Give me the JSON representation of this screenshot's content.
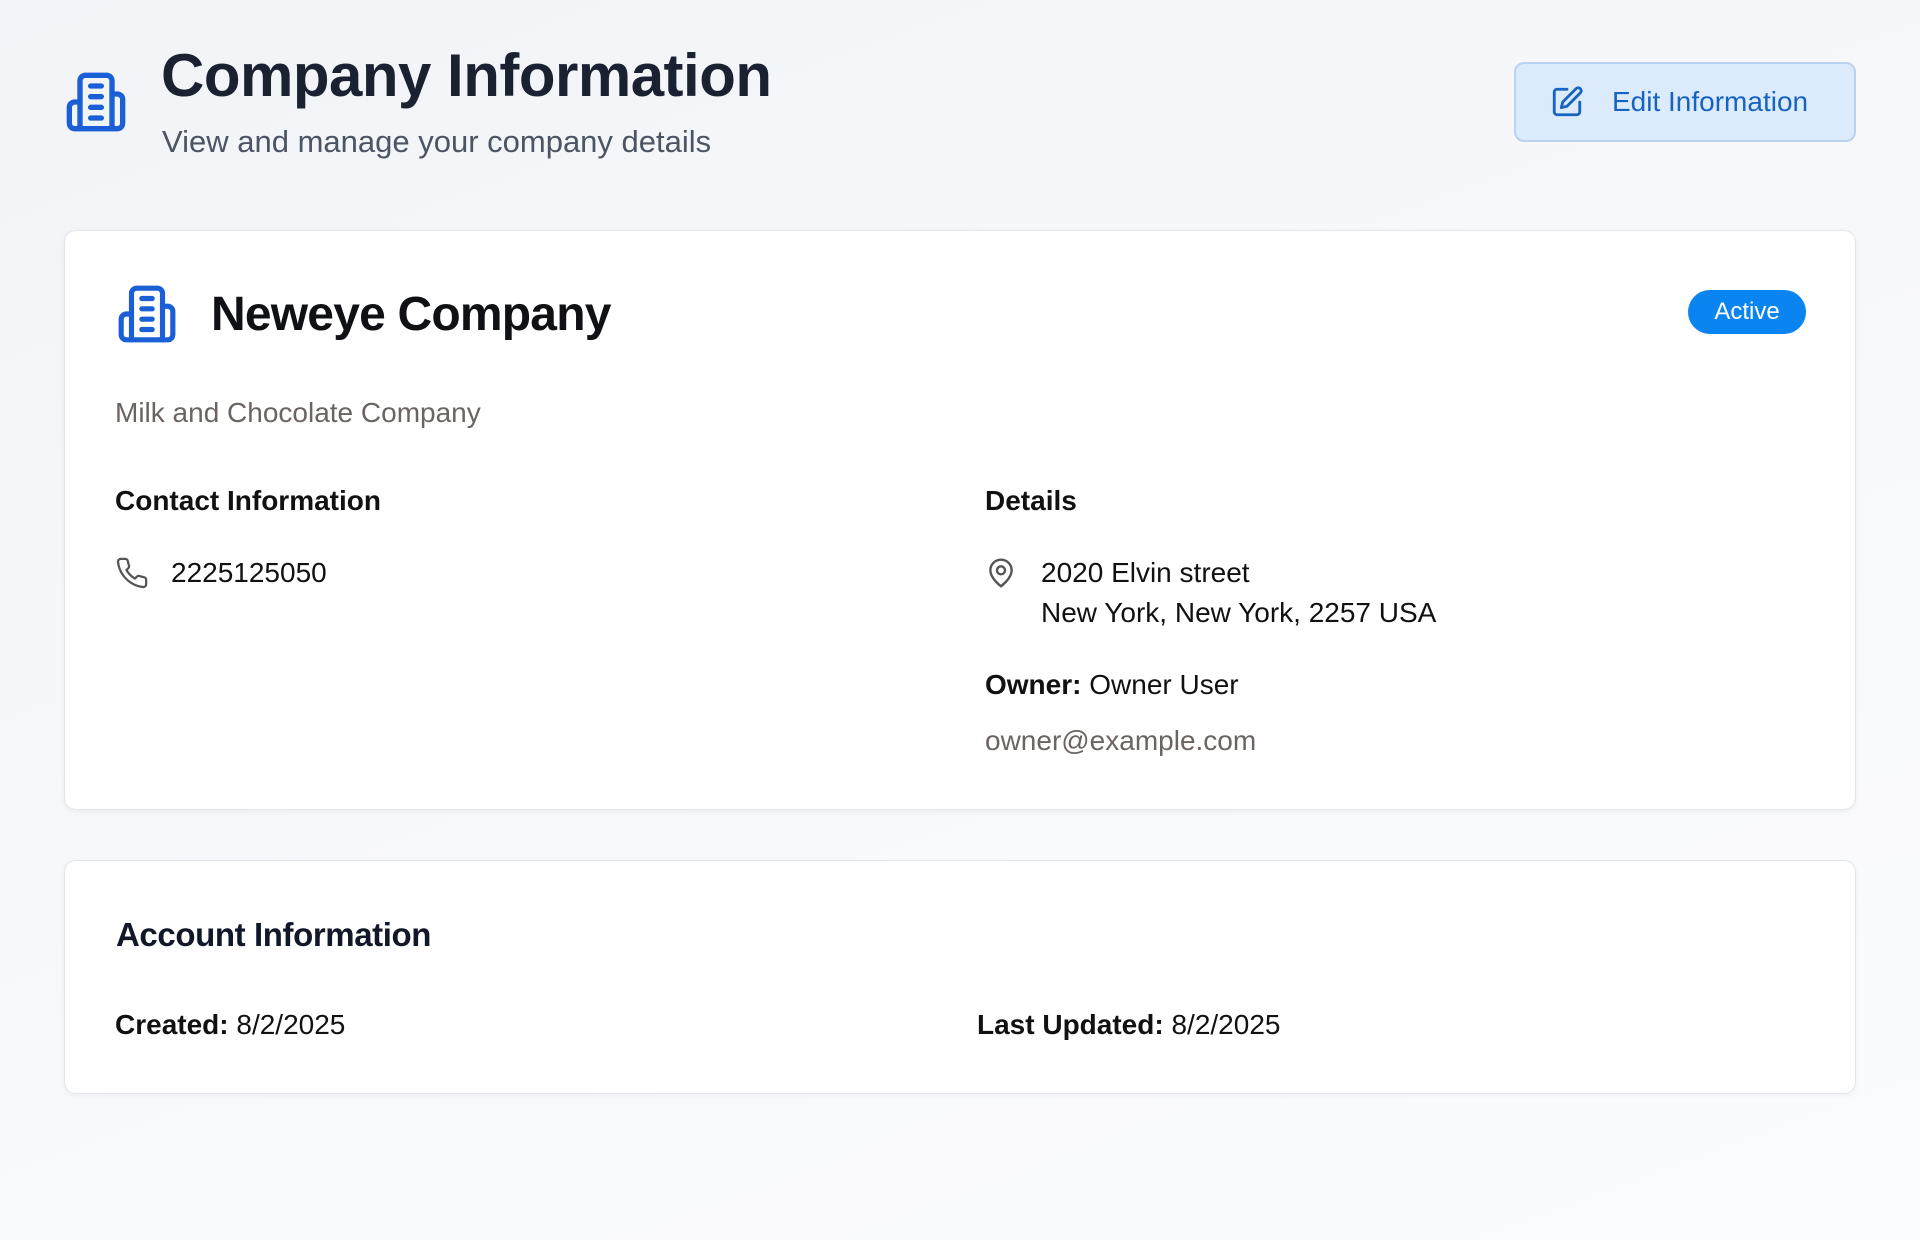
{
  "header": {
    "title": "Company Information",
    "subtitle": "View and manage your company details",
    "icon": "building-icon",
    "edit_button_label": "Edit Information",
    "edit_button_icon": "edit-icon"
  },
  "company": {
    "name": "Neweye Company",
    "icon": "building-icon",
    "status": "Active",
    "status_color": "#0a84f0",
    "description": "Milk and Chocolate Company",
    "contact_heading": "Contact Information",
    "phone": "2225125050",
    "phone_icon": "phone-icon",
    "details_heading": "Details",
    "address_icon": "map-pin-icon",
    "address_line1": "2020 Elvin street",
    "address_line2": "New York, New York, 2257 USA",
    "owner_label": "Owner:",
    "owner_name": "Owner User",
    "owner_email": "owner@example.com"
  },
  "account": {
    "heading": "Account Information",
    "created_label": "Created:",
    "created_value": "8/2/2025",
    "updated_label": "Last Updated:",
    "updated_value": "8/2/2025"
  },
  "colors": {
    "accent": "#1763c2",
    "icon_blue": "#1a5fd6",
    "button_bg": "#dcebfb"
  }
}
